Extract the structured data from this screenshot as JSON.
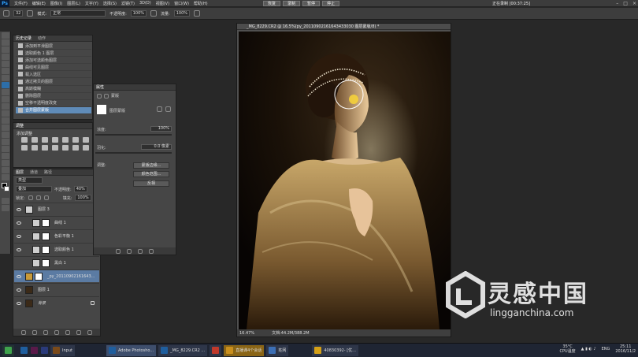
{
  "menu": [
    "文件(F)",
    "编辑(E)",
    "图像(I)",
    "图层(L)",
    "文字(Y)",
    "选择(S)",
    "滤镜(T)",
    "3D(D)",
    "视图(V)",
    "窗口(W)",
    "帮助(H)"
  ],
  "top_buttons": [
    "恢复",
    "录制",
    "暂停",
    "停止"
  ],
  "recording_status": "正在录制 [00:37:25]",
  "ps_logo": "Ps",
  "options": {
    "size": "32",
    "mode_label": "模式:",
    "mode_value": "正常",
    "opacity_label": "不透明度:",
    "opacity_value": "100%",
    "flow_label": "流量:",
    "flow_value": "100%"
  },
  "history": {
    "tabs": [
      "历史记录",
      "动作"
    ],
    "items": [
      "添加到平滑图层",
      "选取颜色 1 图层",
      "添加可选颜色图层",
      "曲线可见图层",
      "载入选区",
      "通过拷贝的图层",
      "高斯模糊",
      "删除图层",
      "空移不透明度改变",
      "合并图层蒙版"
    ]
  },
  "adjustments": {
    "tab": "调整",
    "title": "添加调整"
  },
  "layers": {
    "tabs": [
      "图层",
      "通道",
      "路径"
    ],
    "kind": "类型",
    "blend_mode": "叠加",
    "opacity_label": "不透明度:",
    "opacity_value": "40%",
    "lock_label": "锁定:",
    "fill_label": "填充:",
    "fill_value": "100%",
    "items": [
      {
        "name": "图层 3",
        "kind": "pixel"
      },
      {
        "name": "曲线 1",
        "kind": "adjust"
      },
      {
        "name": "色彩平衡 1",
        "kind": "adjust"
      },
      {
        "name": "选取颜色 1",
        "kind": "adjust"
      },
      {
        "name": "黑白 1",
        "kind": "adjust"
      },
      {
        "name": "_py_20110902161643...",
        "kind": "photo"
      },
      {
        "name": "图层 1",
        "kind": "photo"
      },
      {
        "name": "背景",
        "kind": "photo"
      }
    ]
  },
  "properties": {
    "tab": "属性",
    "subtitle": "蒙版",
    "layer_mask": "图层蒙版",
    "density_label": "浓度:",
    "density_value": "100%",
    "feather_label": "羽化:",
    "feather_value": "0.0 像素",
    "refine_label": "调整:",
    "buttons": [
      "蒙版边缘...",
      "颜色范围...",
      "反相"
    ]
  },
  "document": {
    "tab_title": "_MG_8229.CR2 @ 16.5%(py_20110902161643433030 图层蒙版/8) *",
    "zoom": "16.47%",
    "doc_size": "文档:44.2M/388.2M"
  },
  "watermark": {
    "text": "灵感中国",
    "url": "lingganchina.com"
  },
  "taskbar": {
    "items": [
      {
        "label": "Input",
        "color": "#7a4a1a"
      },
      {
        "label": "Adobe Photosho...",
        "color": "#1f5e9e"
      },
      {
        "label": "_MG_8229.CR2 ...",
        "color": "#1f5e9e"
      },
      {
        "label": "",
        "color": "#c0392b"
      },
      {
        "label": "直播课4个会话",
        "color": "#c98f1e"
      },
      {
        "label": "姓网",
        "color": "#3c6fb5"
      },
      {
        "label": "40830392- [优...",
        "color": "#d4a017"
      }
    ],
    "weather_temp": "35°C",
    "weather_label": "CPU温度",
    "lang": "ENG",
    "time": "25:11",
    "date": "2016/11/2"
  },
  "colors": {
    "accent": "#5f8bb8",
    "panel": "#464646",
    "menubar": "#3c3c3c"
  }
}
